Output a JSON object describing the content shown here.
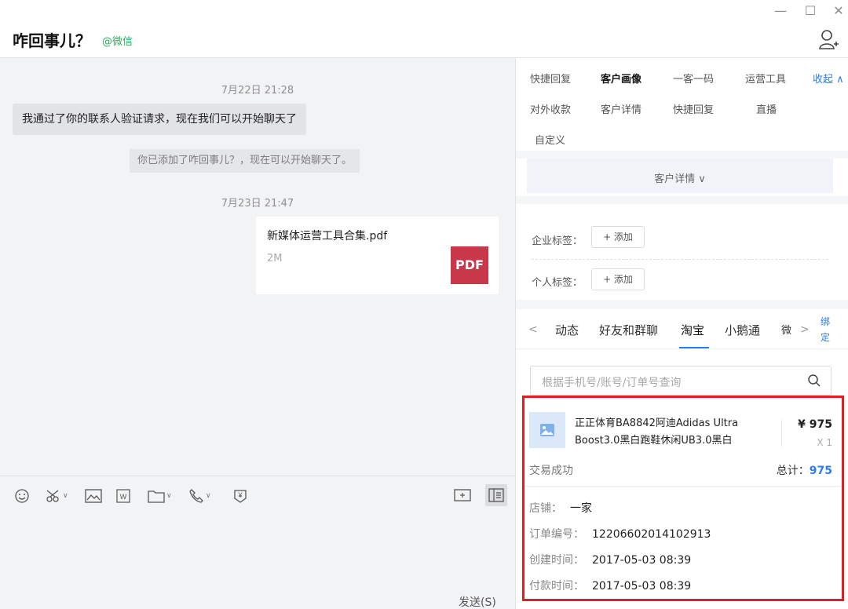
{
  "window": {
    "title": "咋回事儿？",
    "source_tag": "@微信",
    "minimize_glyph": "—",
    "maximize_glyph": "☐",
    "close_glyph": "✕"
  },
  "chat": {
    "timestamps": [
      "7月22日 21:28",
      "7月23日 21:47"
    ],
    "system_bubble": "我通过了你的联系人验证请求，现在我们可以开始聊天了",
    "notice": "你已添加了咋回事儿？，现在可以开始聊天了。",
    "file": {
      "name": "新媒体运营工具合集.pdf",
      "size": "2M",
      "type_badge": "PDF"
    }
  },
  "composer": {
    "tools": [
      "emoji-icon",
      "scissors-icon",
      "image-icon",
      "word-doc-icon",
      "folder-icon",
      "phone-icon",
      "payment-icon",
      "screen-share-icon",
      "sidebar-toggle-icon"
    ],
    "send_label": "发送(S)"
  },
  "panel": {
    "tabs_row1": [
      "快捷回复",
      "客户画像",
      "一客一码",
      "运营工具"
    ],
    "tabs_row2": [
      "对外收款",
      "客户详情",
      "快捷回复",
      "直播"
    ],
    "tabs_row3": [
      "自定义"
    ],
    "collapse_label": "收起 ∧",
    "detail_toggle": "客户详情 ∨",
    "enterprise_tag_label": "企业标签：",
    "personal_tag_label": "个人标签：",
    "add_label": "+ 添加",
    "sub_tabs": [
      "动态",
      "好友和群聊",
      "淘宝",
      "小鹅通",
      "微"
    ],
    "bind_label": "绑定",
    "search_placeholder": "根据手机号/账号/订单号查询"
  },
  "order": {
    "product_name": "正正体育BA8842阿迪Adidas Ultra Boost3.0黑白跑鞋休闲UB3.0黑白",
    "price": "¥ 975",
    "quantity": "X 1",
    "status": "交易成功",
    "total_label": "总计：",
    "total_value": "975",
    "shop_label": "店铺：",
    "shop_value": "一家",
    "order_no_label": "订单编号：",
    "order_no_value": "12206602014102913",
    "created_label": "创建时间：",
    "created_value": "2017-05-03 08:39",
    "paid_label": "付款时间：",
    "paid_value": "2017-05-03 08:39"
  },
  "colors": {
    "accent": "#2b7de9",
    "wechat_green": "#2aae67",
    "highlight_red": "#e02020",
    "pdf_red": "#c8374a"
  }
}
